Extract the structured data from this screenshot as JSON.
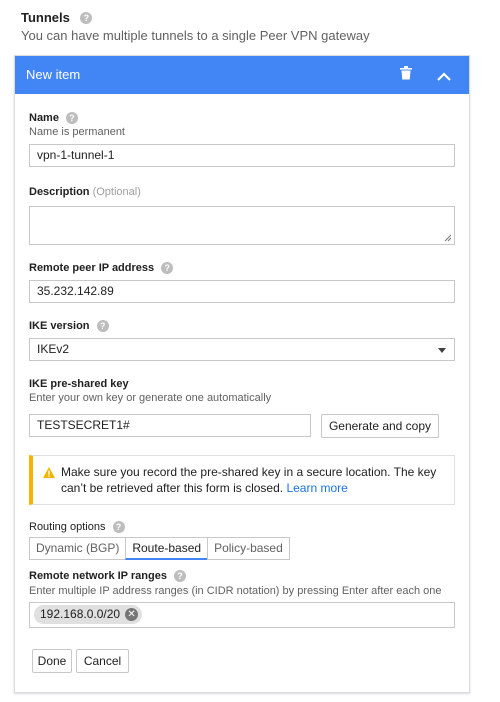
{
  "section": {
    "title": "Tunnels",
    "subtitle": "You can have multiple tunnels to a single Peer VPN gateway"
  },
  "card": {
    "header_title": "New item"
  },
  "form": {
    "name": {
      "label": "Name",
      "hint": "Name is permanent",
      "value": "vpn-1-tunnel-1"
    },
    "description": {
      "label": "Description",
      "optional": "(Optional)",
      "value": ""
    },
    "remote_peer_ip": {
      "label": "Remote peer IP address",
      "value": "35.232.142.89"
    },
    "ike_version": {
      "label": "IKE version",
      "value": "IKEv2"
    },
    "ike_key": {
      "label": "IKE pre-shared key",
      "hint": "Enter your own key or generate one automatically",
      "value": "TESTSECRET1#",
      "generate_button": "Generate and copy"
    },
    "warning": {
      "text": "Make sure you record the pre-shared key in a secure location. The key can’t be retrieved after this form is closed.",
      "link": "Learn more"
    },
    "routing": {
      "label": "Routing options",
      "options": [
        "Dynamic (BGP)",
        "Route-based",
        "Policy-based"
      ],
      "selected": "Route-based"
    },
    "remote_ranges": {
      "label": "Remote network IP ranges",
      "hint": "Enter multiple IP address ranges (in CIDR notation) by pressing Enter after each one",
      "chips": [
        "192.168.0.0/20"
      ]
    }
  },
  "actions": {
    "done": "Done",
    "cancel": "Cancel"
  },
  "colors": {
    "header": "#4285f4",
    "warning_accent": "#f4b400",
    "link": "#1a73e8"
  },
  "icons": {
    "help": "help-circle-icon",
    "delete": "trash-icon",
    "collapse": "chevron-up-icon",
    "warning": "warning-triangle-icon",
    "chip_remove": "close-circle-icon"
  }
}
